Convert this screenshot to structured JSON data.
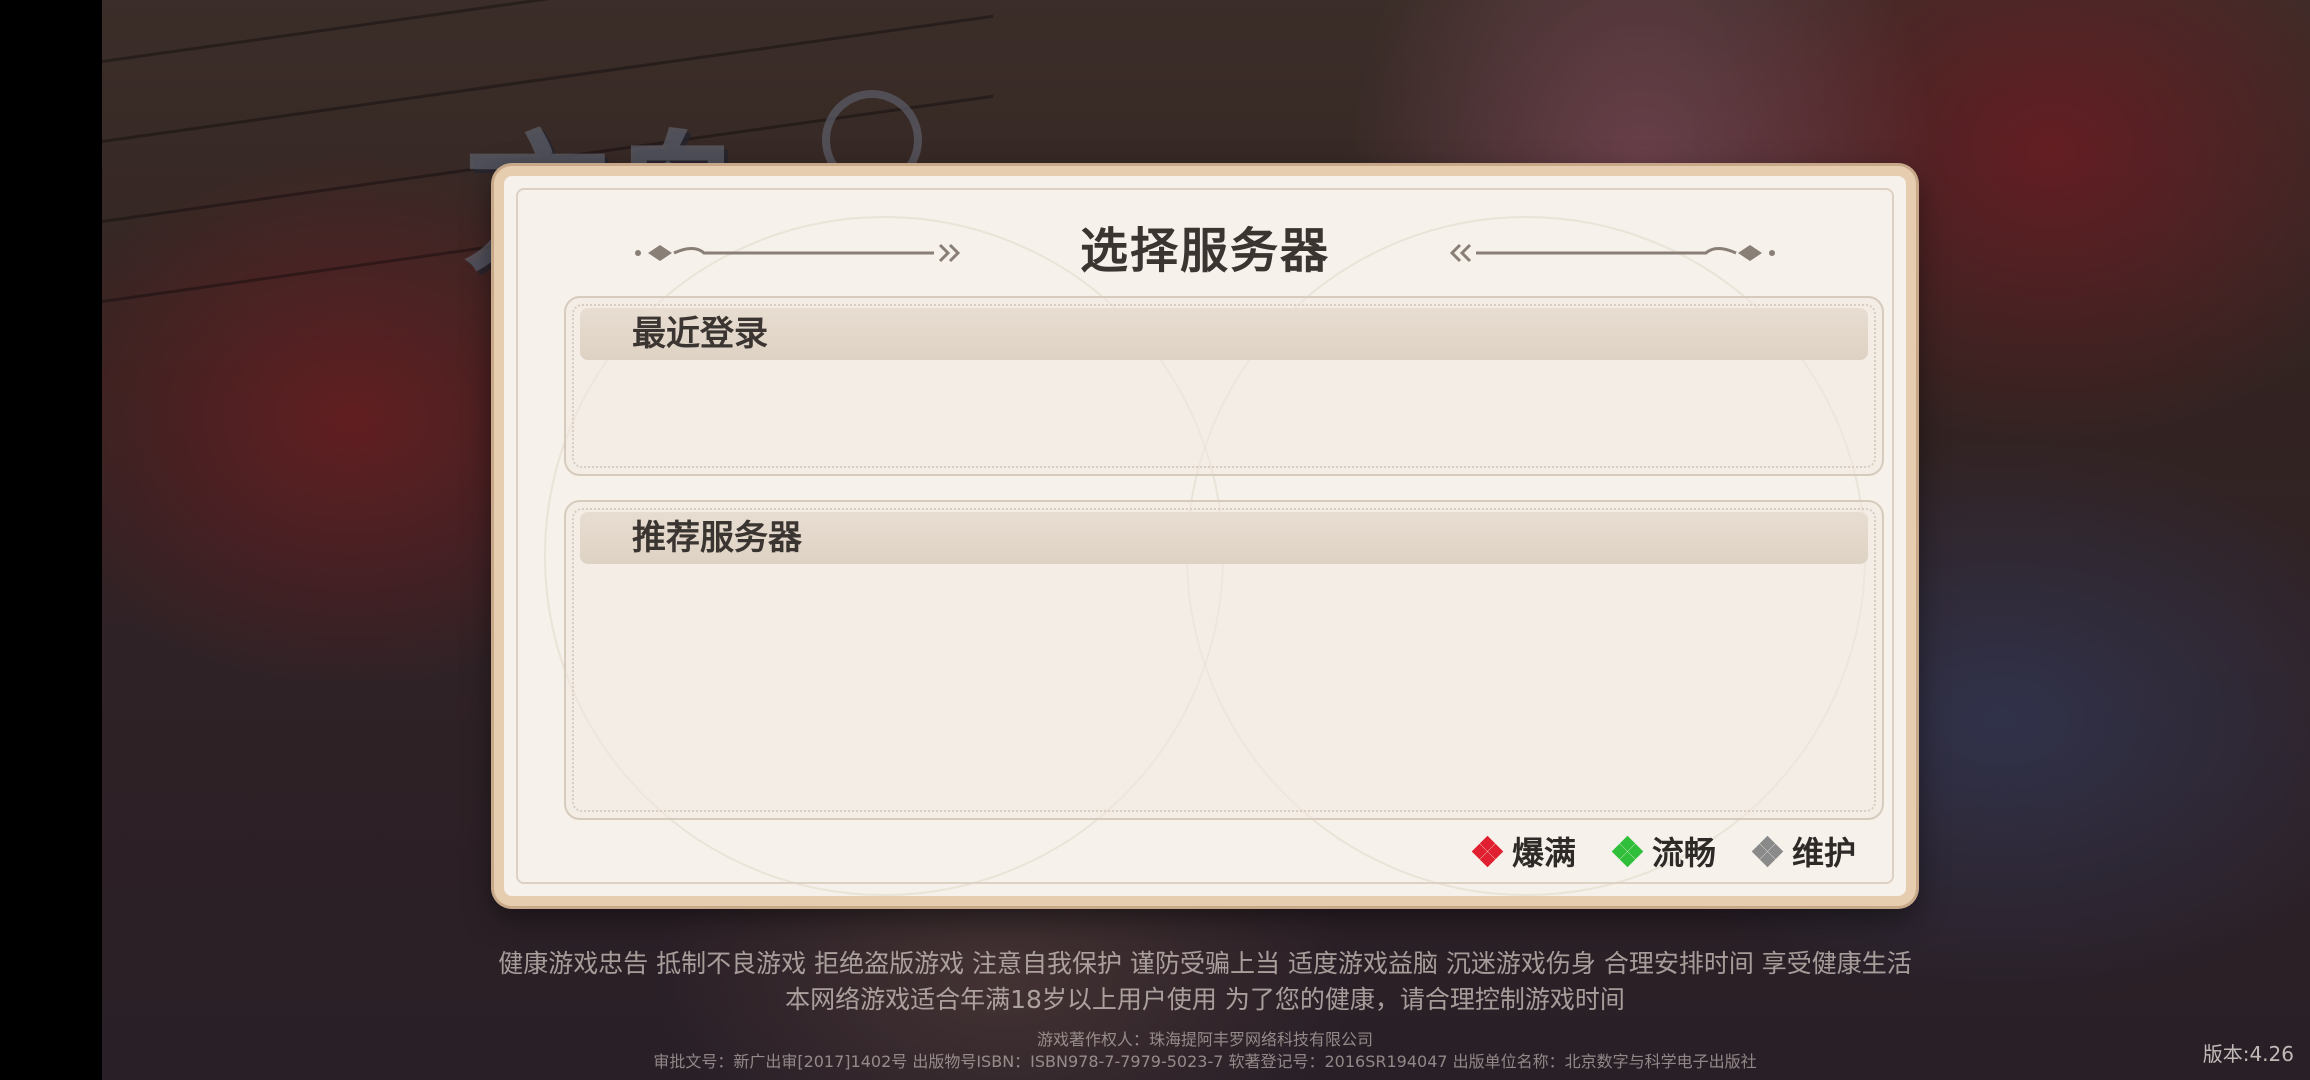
{
  "panel": {
    "title": "选择服务器",
    "sections": [
      {
        "title": "最近登录"
      },
      {
        "title": "推荐服务器"
      }
    ],
    "legend": [
      {
        "label": "爆满",
        "color": "#e02030"
      },
      {
        "label": "流畅",
        "color": "#2fbf3a"
      },
      {
        "label": "维护",
        "color": "#8a8a8a"
      }
    ]
  },
  "footer": {
    "health_notice": "健康游戏忠告  抵制不良游戏  拒绝盗版游戏  注意自我保护  谨防受骗上当  适度游戏益脑  沉迷游戏伤身  合理安排时间  享受健康生活",
    "age_notice": "本网络游戏适合年满18岁以上用户使用    为了您的健康，请合理控制游戏时间",
    "copyright": "游戏著作权人：珠海提阿丰罗网络科技有限公司",
    "approval": "审批文号：新广出审[2017]1402号   出版物号ISBN：ISBN978-7-7979-5023-7   软著登记号：2016SR194047   出版单位名称：北京数字与科学电子出版社"
  },
  "version": "版本:4.26",
  "colors": {
    "panel_bg": "#f6f1ea",
    "panel_border": "#e6cdb0",
    "title_text": "#3b3531"
  }
}
